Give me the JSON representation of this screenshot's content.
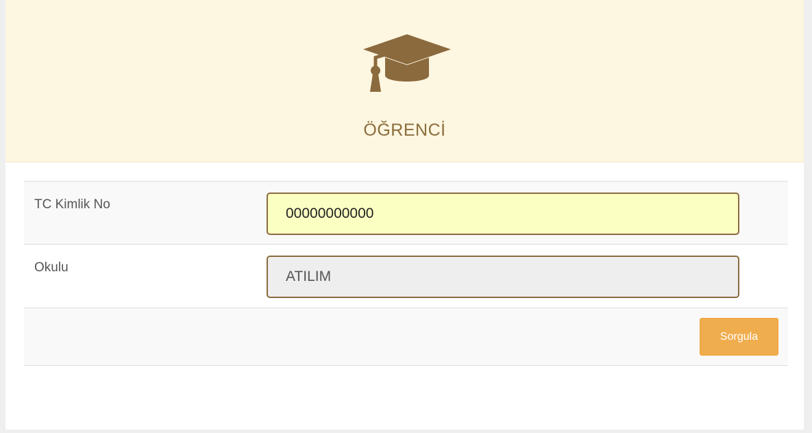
{
  "header": {
    "icon": "graduation-cap-icon",
    "title": "ÖĞRENCİ",
    "background_color": "#fdf6e1",
    "title_color": "#8a6d3b",
    "icon_color": "#8b6a3e"
  },
  "form": {
    "tc": {
      "label": "TC Kimlik No",
      "value": "00000000000"
    },
    "okul": {
      "label": "Okulu",
      "value": "ATILIM"
    },
    "submit_label": "Sorgula",
    "submit_color": "#f0ad4e"
  }
}
